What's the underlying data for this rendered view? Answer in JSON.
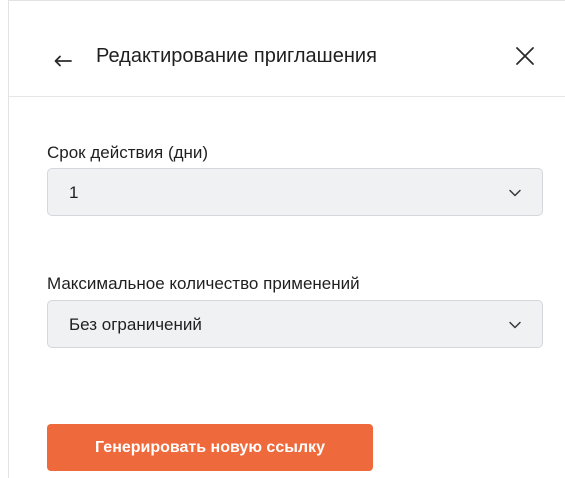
{
  "header": {
    "title": "Редактирование приглашения"
  },
  "expiry": {
    "label": "Срок действия (дни)",
    "value": "1"
  },
  "max_uses": {
    "label": "Максимальное количество применений",
    "value": "Без ограничений"
  },
  "actions": {
    "generate_label": "Генерировать новую ссылку"
  },
  "colors": {
    "accent": "#ee6a3c",
    "select_bg": "#eff1f3"
  }
}
